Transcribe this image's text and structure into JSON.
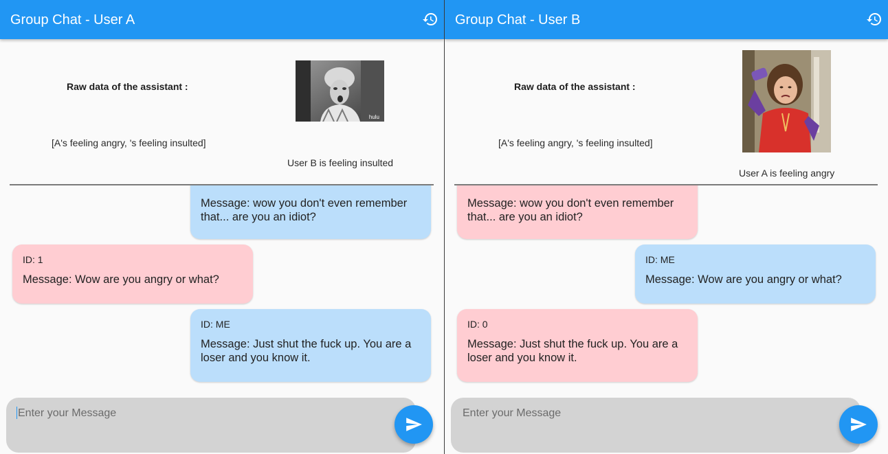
{
  "colors": {
    "app_bar": "#2196f3",
    "my_bubble": "#bbdefb",
    "other_bubble": "#ffcdd2",
    "input_bg": "#d3d3d3"
  },
  "icons": {
    "history": "history-icon",
    "send": "send-icon"
  },
  "panel_a": {
    "title": "Group Chat - User A",
    "raw_label": "Raw data of the assistant :",
    "raw_list": "[A's feeling angry, 's feeling insulted]",
    "gif_caption": "User B is feeling insulted",
    "gif_watermark": "hulu",
    "messages": [
      {
        "text": "Message: wow you don't even remember that... are you an idiot?"
      },
      {
        "id": "ID: 1",
        "text": "Message: Wow are you angry or what?"
      },
      {
        "id": "ID: ME",
        "text": "Message: Just shut the fuck up. You are a loser and you know it."
      }
    ],
    "input_placeholder": "Enter your Message"
  },
  "panel_b": {
    "title": "Group Chat - User B",
    "raw_label": "Raw data of the assistant :",
    "raw_list": "[A's feeling angry, 's feeling insulted]",
    "gif_caption": "User A is feeling angry",
    "messages": [
      {
        "text": "Message: wow you don't even remember that... are you an idiot?"
      },
      {
        "id": "ID: ME",
        "text": "Message: Wow are you angry or what?"
      },
      {
        "id": "ID: 0",
        "text": "Message: Just shut the fuck up. You are a loser and you know it."
      }
    ],
    "input_placeholder": "Enter your Message"
  }
}
